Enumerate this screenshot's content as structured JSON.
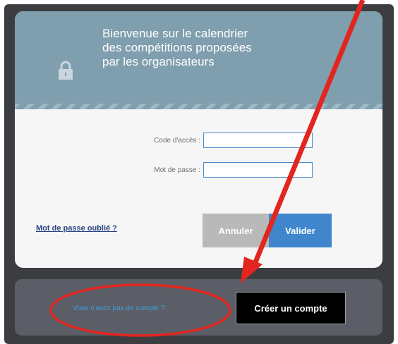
{
  "header": {
    "welcome_line1": "Bienvenue sur le calendrier",
    "welcome_line2": "des compétitions proposées",
    "welcome_line3": "par les organisateurs",
    "icon": "lock-icon"
  },
  "form": {
    "access_code_label": "Code d'accès :",
    "access_code_value": "",
    "password_label": "Mot de passe :",
    "password_value": "",
    "forgot_password": "Mot de passe oublié ?",
    "cancel_label": "Annuler",
    "submit_label": "Valider"
  },
  "footer": {
    "no_account_text": "Vous n'avez pas de compte ?",
    "create_account_label": "Créer un compte"
  },
  "colors": {
    "header_bg": "#7f9eae",
    "annotation_red": "#e3251f",
    "submit_blue": "#3f86cc"
  }
}
